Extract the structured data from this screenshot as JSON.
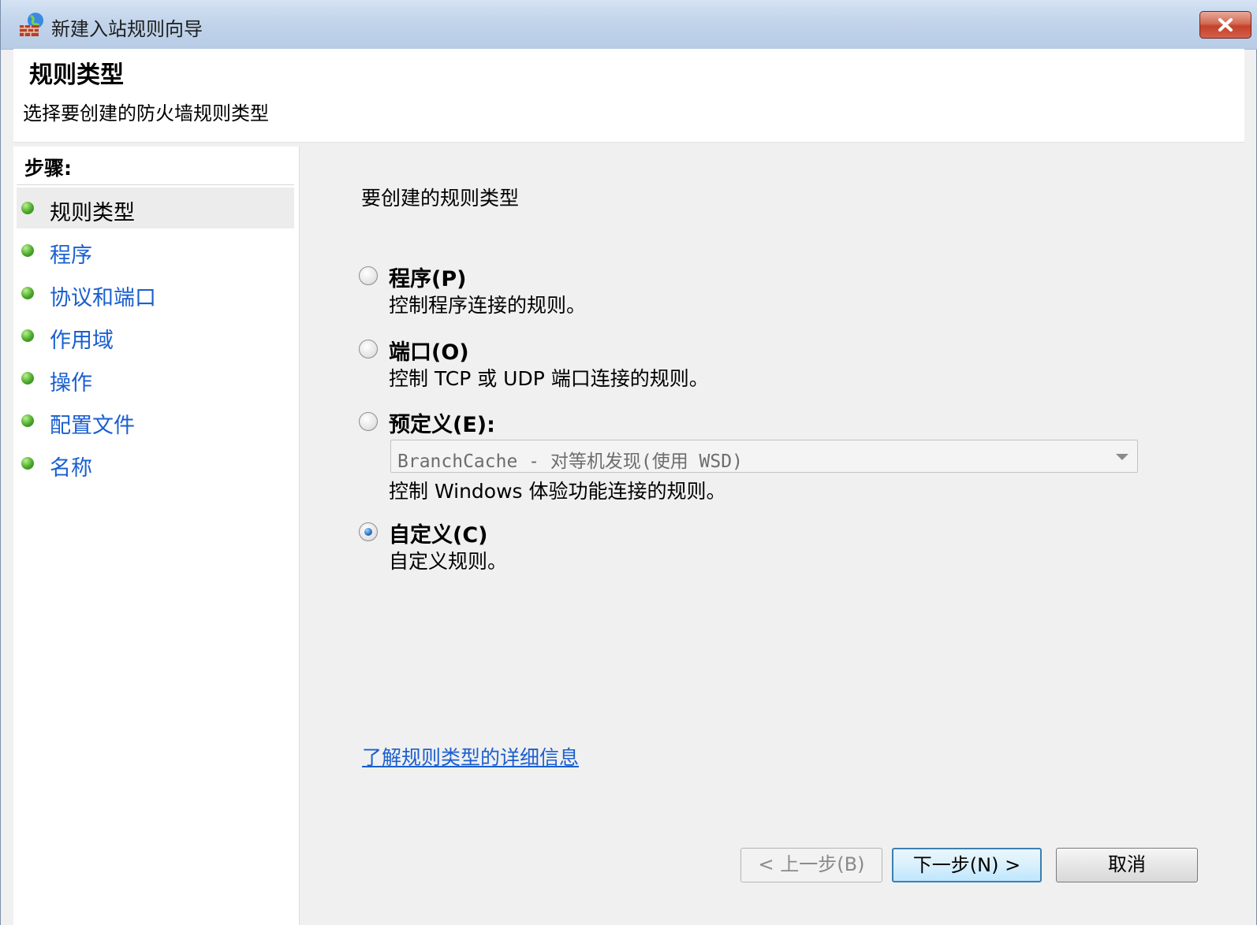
{
  "window": {
    "title": "新建入站规则向导",
    "icon": "firewall-globe-icon"
  },
  "header": {
    "title": "规则类型",
    "subtitle": "选择要创建的防火墙规则类型"
  },
  "steps": {
    "title": "步骤:",
    "items": [
      {
        "label": "规则类型",
        "current": true
      },
      {
        "label": "程序",
        "current": false
      },
      {
        "label": "协议和端口",
        "current": false
      },
      {
        "label": "作用域",
        "current": false
      },
      {
        "label": "操作",
        "current": false
      },
      {
        "label": "配置文件",
        "current": false
      },
      {
        "label": "名称",
        "current": false
      }
    ]
  },
  "content": {
    "heading": "要创建的规则类型",
    "options": [
      {
        "label": "程序(P)",
        "description": "控制程序连接的规则。",
        "checked": false
      },
      {
        "label": "端口(O)",
        "description": "控制 TCP 或 UDP 端口连接的规则。",
        "checked": false
      },
      {
        "label": "预定义(E):",
        "description": "控制 Windows 体验功能连接的规则。",
        "checked": false
      },
      {
        "label": "自定义(C)",
        "description": "自定义规则。",
        "checked": true
      }
    ],
    "predefined_select": {
      "value": "BranchCache - 对等机发现(使用 WSD)",
      "enabled": false
    },
    "learn_more_link": "了解规则类型的详细信息"
  },
  "buttons": {
    "back": "< 上一步(B)",
    "next": "下一步(N) >",
    "cancel": "取消"
  },
  "colors": {
    "link": "#1a5fd0",
    "close_button": "#c4412b",
    "step_bullet": "#4aa82a"
  }
}
